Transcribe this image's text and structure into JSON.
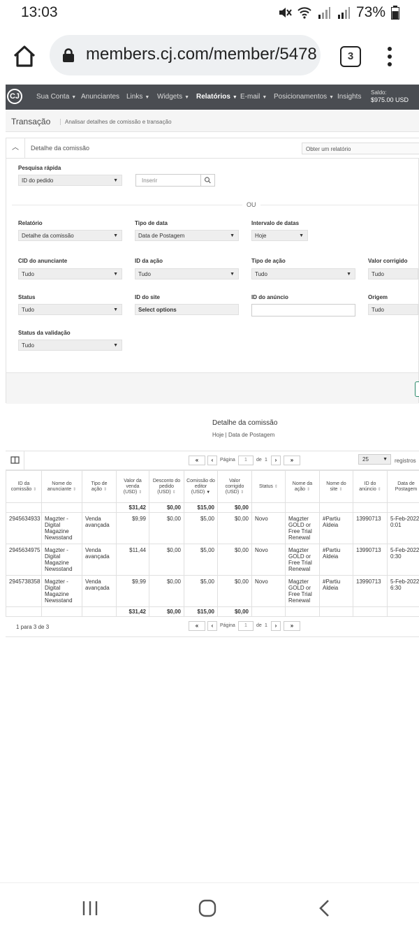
{
  "status_bar": {
    "time": "13:03",
    "battery": "73%"
  },
  "browser": {
    "url": "members.cj.com/member/5478",
    "tab_count": "3"
  },
  "nav": {
    "logo": "CJ",
    "items": [
      {
        "label": "Sua Conta",
        "caret": true
      },
      {
        "label": "Anunciantes",
        "caret": false
      },
      {
        "label": "Links",
        "caret": true
      },
      {
        "label": "Widgets",
        "caret": true
      },
      {
        "label": "Relatórios",
        "caret": true,
        "active": true
      },
      {
        "label": "E-mail",
        "caret": true
      },
      {
        "label": "Posicionamentos",
        "caret": true
      },
      {
        "label": "Insights",
        "caret": false
      }
    ],
    "saldo_label": "Saldo:",
    "saldo_value": "$975.00 USD"
  },
  "page": {
    "title": "Transação",
    "subtitle": "Analisar detalhes de comissão e transação"
  },
  "panel": {
    "title": "Detalhe da comissão",
    "get_report": "Obter um relatório",
    "quick_search_label": "Pesquisa rápida",
    "quick_search_select": "ID do pedido",
    "search_placeholder": "Inserir",
    "or": "OU",
    "fields": {
      "relatorio": {
        "label": "Relatório",
        "value": "Detalhe da comissão"
      },
      "tipo_data": {
        "label": "Tipo de data",
        "value": "Data de Postagem"
      },
      "intervalo": {
        "label": "Intervalo de datas",
        "value": "Hoje"
      },
      "cid": {
        "label": "CID do anunciante",
        "value": "Tudo"
      },
      "id_acao": {
        "label": "ID da ação",
        "value": "Tudo"
      },
      "tipo_acao": {
        "label": "Tipo de ação",
        "value": "Tudo"
      },
      "valor_corrigido": {
        "label": "Valor corrigido",
        "value": "Tudo"
      },
      "status": {
        "label": "Status",
        "value": "Tudo"
      },
      "id_site": {
        "label": "ID do site",
        "value": "Select options"
      },
      "id_anuncio": {
        "label": "ID do anúncio",
        "value": ""
      },
      "origem": {
        "label": "Origem",
        "value": "Tudo"
      },
      "status_validacao": {
        "label": "Status da validação",
        "value": "Tudo"
      }
    }
  },
  "report": {
    "title": "Detalhe da comissão",
    "subtitle": "Hoje | Data de Postagem",
    "pagination": {
      "page_label": "Página",
      "page": "1",
      "of_label": "de",
      "total_pages": "1",
      "page_size": "25",
      "per_page_label": "registros"
    },
    "columns": [
      "ID da comissão",
      "Nome do anunciante",
      "Tipo de ação",
      "Valor da venda (USD)",
      "Desconto do pedido (USD)",
      "Comissão do editor (USD)",
      "Valor corrigido (USD)",
      "Status",
      "Nome da ação",
      "Nome do site",
      "ID do anúncio",
      "Data de Postagem"
    ],
    "totals": {
      "sale": "$31,42",
      "discount": "$0,00",
      "commission": "$15,00",
      "corrected": "$0,00"
    },
    "rows": [
      {
        "id": "2945634933",
        "advertiser": "Magzter - Digital Magazine Newsstand",
        "action_type": "Venda avançada",
        "sale": "$9,99",
        "discount": "$0,00",
        "commission": "$5,00",
        "corrected": "$0,00",
        "status": "Novo",
        "action_name": "Magzter GOLD or Free Trial Renewal",
        "site": "#Partiu Aldeia",
        "ad_id": "13990713",
        "date": "5-Feb-2022 0:01"
      },
      {
        "id": "2945634975",
        "advertiser": "Magzter - Digital Magazine Newsstand",
        "action_type": "Venda avançada",
        "sale": "$11,44",
        "discount": "$0,00",
        "commission": "$5,00",
        "corrected": "$0,00",
        "status": "Novo",
        "action_name": "Magzter GOLD or Free Trial Renewal",
        "site": "#Partiu Aldeia",
        "ad_id": "13990713",
        "date": "5-Feb-2022 0:30"
      },
      {
        "id": "2945738358",
        "advertiser": "Magzter - Digital Magazine Newsstand",
        "action_type": "Venda avançada",
        "sale": "$9,99",
        "discount": "$0,00",
        "commission": "$5,00",
        "corrected": "$0,00",
        "status": "Novo",
        "action_name": "Magzter GOLD or Free Trial Renewal",
        "site": "#Partiu Aldeia",
        "ad_id": "13990713",
        "date": "5-Feb-2022 6:30"
      }
    ],
    "range_text": "1 para 3 de 3"
  },
  "colors": {
    "nav_bg": "#4a4d52",
    "link": "#1a6f7a",
    "accent_green": "#2a8a6a"
  }
}
